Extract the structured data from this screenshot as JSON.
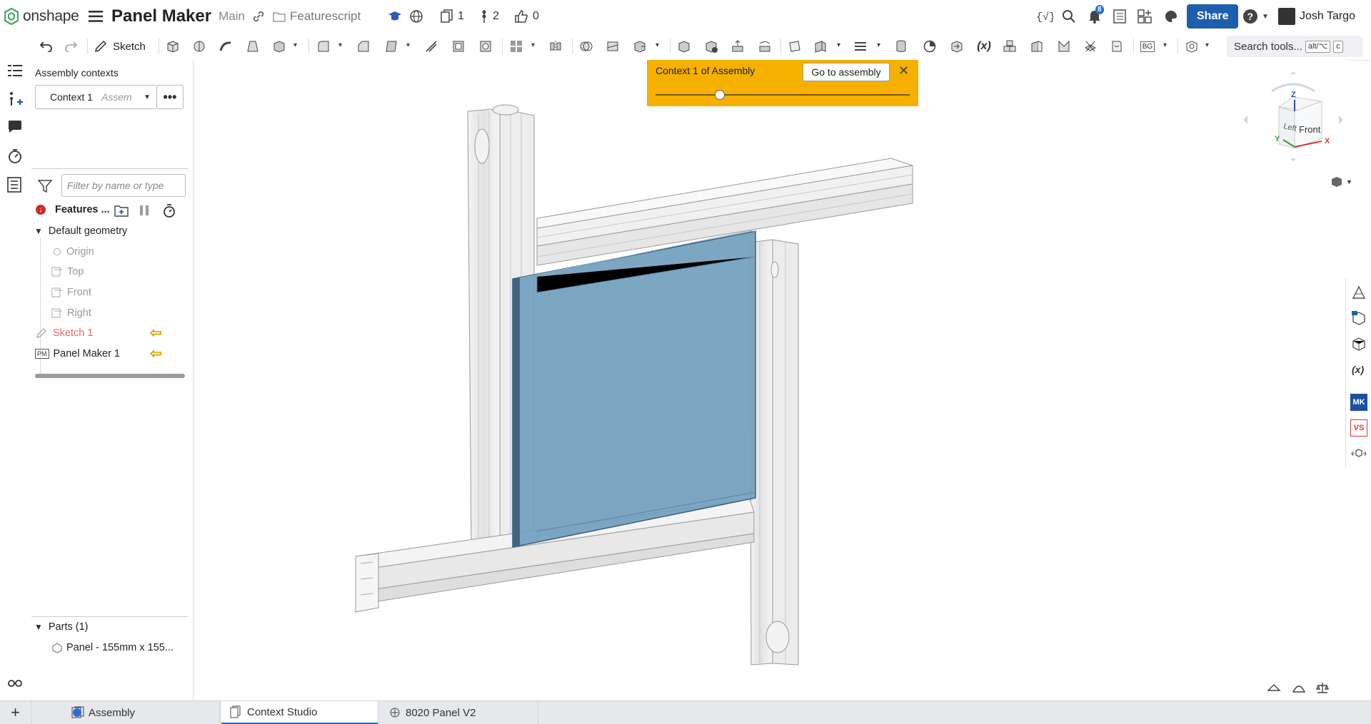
{
  "header": {
    "logo_text": "onshape",
    "document_title": "Panel Maker",
    "workspace": "Main",
    "folder": "Featurescript",
    "versions_count": "1",
    "branches_count": "2",
    "likes_count": "0",
    "notifications_count": "8",
    "share_label": "Share",
    "user_name": "Josh Targo"
  },
  "toolbar": {
    "sketch_label": "Sketch",
    "search_tools_label": "Search tools...",
    "search_shortcut_1": "alt/⌥",
    "search_shortcut_2": "c",
    "bg_label": "BG",
    "variable_label": "(x)"
  },
  "feature_panel": {
    "title": "Assembly contexts",
    "context_value": "Context 1",
    "context_assembly": "Assem",
    "more_label": "•••",
    "filter_placeholder": "Filter by name or type",
    "features_label": "Features ...",
    "default_geometry": "Default geometry",
    "geometry_items": [
      "Origin",
      "Top",
      "Front",
      "Right"
    ],
    "sketch_item": "Sketch 1",
    "panel_maker_prefix": "PM",
    "panel_maker_item": "Panel Maker 1",
    "parts_header": "Parts (1)",
    "part_item": "Panel - 155mm x 155..."
  },
  "context_banner": {
    "label": "Context 1 of Assembly",
    "go_button": "Go to assembly",
    "close": "✕",
    "slider_position": 0.25
  },
  "view_cube": {
    "face_front": "Front",
    "face_left": "Left",
    "axis_x": "X",
    "axis_y": "Y",
    "axis_z": "Z"
  },
  "right_panel": {
    "mk_label": "MK",
    "vs_label": "VS"
  },
  "tabs": [
    {
      "label": "Assembly",
      "active": false
    },
    {
      "label": "Context Studio",
      "active": true
    },
    {
      "label": "8020 Panel V2",
      "active": false
    }
  ],
  "colors": {
    "accent_blue": "#1d5fad",
    "banner_yellow": "#f5b000",
    "panel_blue": "#6f9cbd"
  }
}
